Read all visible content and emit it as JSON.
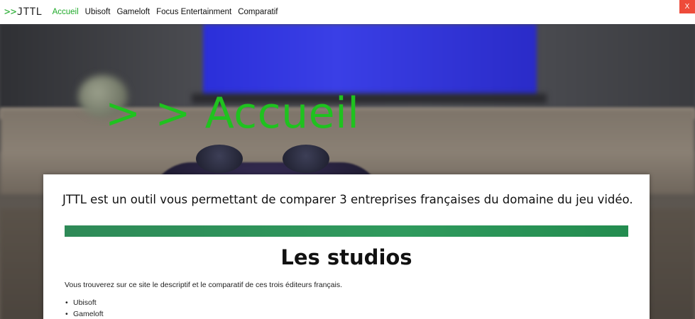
{
  "brand": {
    "arrows": ">>",
    "name": "JTTL"
  },
  "nav": {
    "items": [
      {
        "label": "Accueil",
        "active": true
      },
      {
        "label": "Ubisoft",
        "active": false
      },
      {
        "label": "Gameloft",
        "active": false
      },
      {
        "label": "Focus Entertainment",
        "active": false
      },
      {
        "label": "Comparatif",
        "active": false
      }
    ]
  },
  "window": {
    "close_label": "X"
  },
  "hero": {
    "title": "> > Accueil"
  },
  "main": {
    "intro": "JTTL est un outil vous permettant de comparer 3 entreprises françaises du domaine du jeu vidéo.",
    "section_title": "Les studios",
    "description": "Vous trouverez sur ce site le descriptif et le comparatif de ces trois éditeurs français.",
    "studios": [
      "Ubisoft",
      "Gameloft"
    ]
  },
  "colors": {
    "accent": "#1faa2a",
    "hero_title": "#1fc21f",
    "divider": "#2e8a57",
    "close_button": "#ee4b3a"
  }
}
